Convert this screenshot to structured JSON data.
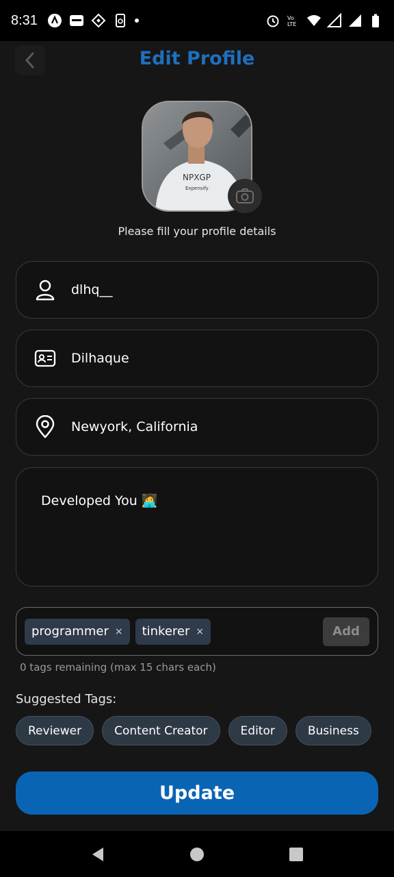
{
  "status_bar": {
    "time": "8:31",
    "left_icons": [
      "n-app-icon",
      "blinkit-icon",
      "binance-icon",
      "phone-sync-icon",
      "notification-dot-icon"
    ],
    "right_icons": [
      "alarm-icon",
      "volte-icon",
      "wifi-icon",
      "signal-icon",
      "signal-icon",
      "battery-icon"
    ]
  },
  "header": {
    "title": "Edit Profile",
    "back_icon": "chevron-left-icon"
  },
  "profile": {
    "subtitle": "Please fill your profile details",
    "camera_icon": "camera-icon"
  },
  "fields": {
    "username": {
      "value": "dlhq__",
      "icon": "user-icon"
    },
    "name": {
      "value": "Dilhaque",
      "icon": "id-card-icon"
    },
    "location": {
      "value": "Newyork, California",
      "icon": "location-pin-icon"
    },
    "bio": {
      "value": "Developed You 🧑‍💻"
    }
  },
  "tags": {
    "items": [
      {
        "label": "programmer",
        "remove": "×"
      },
      {
        "label": "tinkerer",
        "remove": "×"
      }
    ],
    "add_label": "Add",
    "hint": "0 tags remaining (max 15 chars each)"
  },
  "suggested": {
    "heading": "Suggested Tags:",
    "items": [
      "Reviewer",
      "Content Creator",
      "Editor",
      "Business"
    ]
  },
  "update_label": "Update",
  "colors": {
    "accent": "#0a64b4",
    "title": "#1f6fbd",
    "background": "#161616",
    "chip": "#2f3a4a"
  }
}
